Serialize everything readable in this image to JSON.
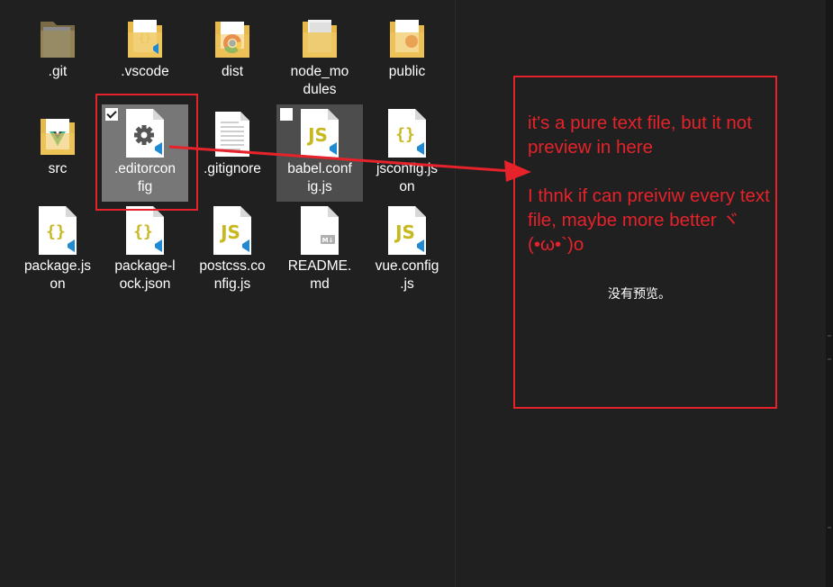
{
  "files": [
    {
      "name": ".git",
      "icon": "folder-icon"
    },
    {
      "name": ".vscode",
      "icon": "folder-icon"
    },
    {
      "name": "dist",
      "icon": "folder-chrome-icon"
    },
    {
      "name": "node_modules",
      "icon": "folder-icon"
    },
    {
      "name": "public",
      "icon": "folder-icon"
    },
    {
      "name": "src",
      "icon": "folder-vue-icon"
    },
    {
      "name": ".editorconfig",
      "icon": "gear-file-icon",
      "selected": true,
      "checked": true
    },
    {
      "name": ".gitignore",
      "icon": "text-file-icon"
    },
    {
      "name": "babel.config.js",
      "icon": "js-file-icon",
      "hovered": true,
      "checked": false
    },
    {
      "name": "jsconfig.json",
      "icon": "json-file-icon"
    },
    {
      "name": "package.json",
      "icon": "json-file-icon"
    },
    {
      "name": "package-lock.json",
      "icon": "json-file-icon"
    },
    {
      "name": "postcss.config.js",
      "icon": "js-file-icon"
    },
    {
      "name": "README.md",
      "icon": "markdown-file-icon"
    },
    {
      "name": "vue.config.js",
      "icon": "js-file-icon"
    }
  ],
  "file_labels": {
    "git": ".git",
    "vscode": ".vscode",
    "dist": "dist",
    "node_modules": "node_mo\ndules",
    "public": "public",
    "src": "src",
    "editorconfig": ".editorcon\nfig",
    "gitignore": ".gitignore",
    "babel": "babel.conf\nig.js",
    "jsconfig": "jsconfig.js\non",
    "package": "package.js\non",
    "package_lock": "package-l\nock.json",
    "postcss": "postcss.co\nnfig.js",
    "readme": "README.\nmd",
    "vue_config": "vue.config\n.js"
  },
  "preview": {
    "no_preview_text": "没有预览。"
  },
  "annotation": {
    "text": "it's a pure text file, but it not preview in here\n\nI thnk if can  preiviw every text file, maybe more better ヾ(•ω•`)o",
    "color": "#e6222a"
  },
  "colors": {
    "background": "#202020",
    "selected_item": "#777777",
    "hovered_item": "#4d4d4d",
    "folder": "#e8b94a",
    "vscode_blue": "#1f8ad2",
    "js_yellow": "#c8b820"
  }
}
